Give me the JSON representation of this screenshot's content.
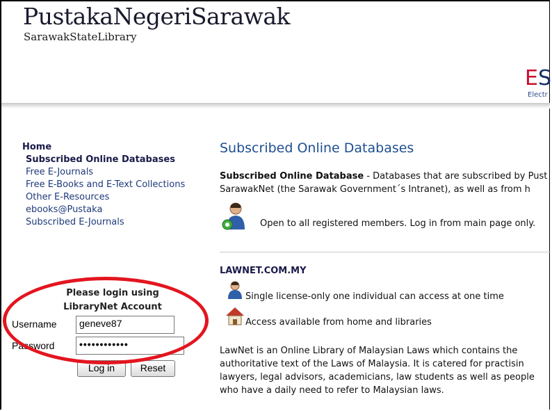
{
  "header": {
    "brand_main": "PustakaNegeriSarawak",
    "brand_sub": "SarawakStateLibrary",
    "eservice_first": "E",
    "eservice_rest": "S",
    "eservice_small": "Electr"
  },
  "sidebar": {
    "home": "Home",
    "items": [
      {
        "label": "Subscribed Online Databases",
        "active": true
      },
      {
        "label": "Free E-Journals"
      },
      {
        "label": "Free E-Books and E-Text Collections"
      },
      {
        "label": "Other E-Resources"
      },
      {
        "label": "ebooks@Pustaka"
      },
      {
        "label": "Subscribed E-Journals"
      }
    ]
  },
  "login": {
    "title_line1": "Please login using",
    "title_line2": "LibraryNet Account",
    "username_label": "Username",
    "username_value": "geneve87",
    "password_label": "Password",
    "password_value": "••••••••••••",
    "login_button": "Log in",
    "reset_button": "Reset"
  },
  "main": {
    "title": "Subscribed Online Databases",
    "intro_bold": "Subscribed Online Database",
    "intro_rest": " - Databases that are subscribed by Pust",
    "intro_line2": "SarawakNet (the Sarawak Government´s Intranet), as well as from h",
    "open_text": "Open to all registered members. Log in from main page only.",
    "lawnet": {
      "title": "LAWNET.COM.MY",
      "license_text": "Single license-only one individual can access at one time",
      "home_text": "Access available from home and libraries",
      "description": [
        "LawNet is an Online Library of Malaysian Laws which contains the",
        "authoritative text of the Laws of Malaysia. It is catered for practisin",
        "lawyers, legal advisors, academicians, law students as well as people",
        "who have a daily need to refer to Malaysian laws."
      ]
    }
  },
  "annotation": {
    "color": "#e3151f",
    "shape": "ellipse"
  },
  "icons": {
    "open": "users-icon",
    "license": "single-user-icon",
    "home": "house-icon"
  }
}
